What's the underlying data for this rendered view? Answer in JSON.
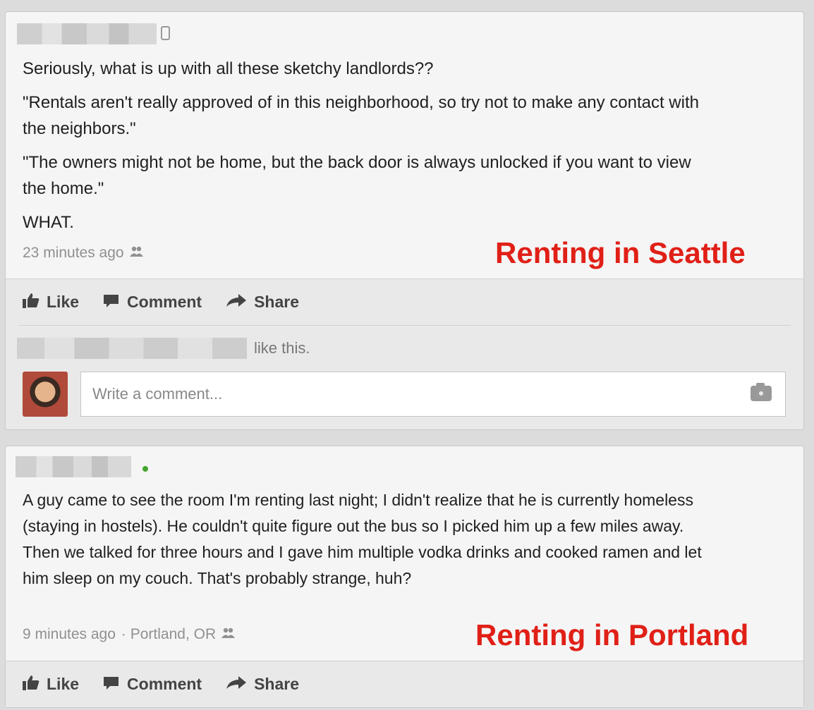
{
  "posts": [
    {
      "paragraphs": [
        "Seriously, what is up with all these sketchy landlords??",
        "\"Rentals aren't really approved of in this neighborhood, so try not to make any contact with the neighbors.\"",
        "\"The owners might not be home, but the back door is always unlocked if you want to view the home.\"",
        "WHAT."
      ],
      "time": "23 minutes ago",
      "location": "",
      "label": "Renting in Seattle",
      "actions": {
        "like": "Like",
        "comment": "Comment",
        "share": "Share"
      },
      "likes_suffix": "like this.",
      "comment_placeholder": "Write a comment..."
    },
    {
      "paragraphs": [
        "A guy came to see the room I'm renting last night; I didn't realize that he is currently homeless (staying in hostels). He couldn't quite figure out the bus so I picked him up a few miles away. Then we talked for three hours and I gave him multiple vodka drinks and cooked ramen and let him sleep on my couch. That's probably strange, huh?"
      ],
      "time": "9 minutes ago",
      "location": "· Portland, OR",
      "label": "Renting in Portland",
      "actions": {
        "like": "Like",
        "comment": "Comment",
        "share": "Share"
      }
    }
  ],
  "colors": {
    "label": "#e02017",
    "online": "#42a52c"
  },
  "icons": [
    "mobile-icon",
    "online-dot-icon",
    "friends-icon",
    "like-thumb-icon",
    "comment-icon",
    "share-arrow-icon",
    "camera-icon"
  ]
}
